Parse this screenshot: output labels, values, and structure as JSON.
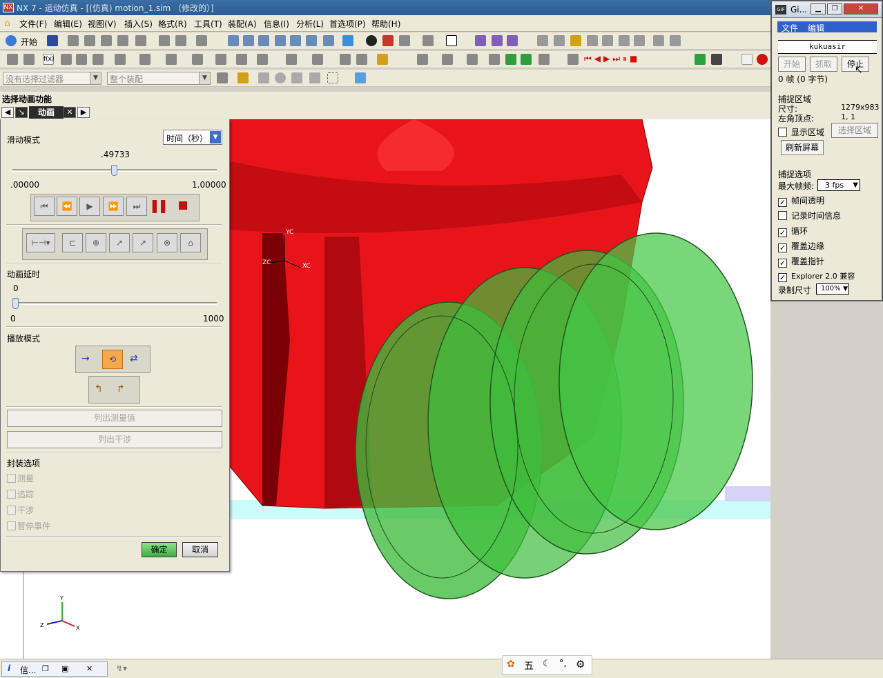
{
  "window": {
    "title": "NX 7 - 运动仿真 - [(仿真) motion_1.sim （修改的）]"
  },
  "menu": [
    "文件(F)",
    "编辑(E)",
    "视图(V)",
    "插入(S)",
    "格式(R)",
    "工具(T)",
    "装配(A)",
    "信息(I)",
    "分析(L)",
    "首选项(P)",
    "帮助(H)"
  ],
  "toolbar": {
    "start_label": "开始",
    "filter_placeholder": "没有选择过滤器",
    "assembly_scope": "整个装配"
  },
  "cue": "选择动画功能",
  "tab": {
    "label": "动画"
  },
  "animation": {
    "slide_mode_label": "滑动模式",
    "slide_mode_value": "时间（秒）",
    "time_value": ".49733",
    "time_fraction": 0.49733,
    "time_min": ".00000",
    "time_max": "1.00000",
    "delay_label": "动画延时",
    "delay_value": "0",
    "delay_min": "0",
    "delay_max": "1000",
    "play_mode_label": "播放模式",
    "list_measure": "列出测量值",
    "list_interference": "列出干涉",
    "package_label": "封装选项",
    "package_options": [
      "测量",
      "追踪",
      "干涉",
      "暂停事件"
    ],
    "ok": "确定",
    "cancel": "取消"
  },
  "csys": {
    "yc": "YC",
    "zc": "ZC",
    "xc": "XC",
    "y": "Y",
    "z": "Z",
    "x": "X"
  },
  "gif": {
    "title": "Gi...",
    "menu": [
      "文件",
      "编辑"
    ],
    "name": "kukuasir",
    "start": "开始",
    "grab": "抓取",
    "stop": "停止",
    "frames": "0 帧 (0 字节)",
    "capture_area_label": "捕捉区域",
    "size_label": "尺寸:",
    "size_value": "1279x983",
    "corner_label": "左角顶点:",
    "corner_value": "1, 1",
    "show_area": "显示区域",
    "select_area": "选择区域",
    "refresh": "刷新屏幕",
    "capture_options_label": "捕捉选项",
    "max_fps_label": "最大帧频:",
    "max_fps_value": "3 fps",
    "options": [
      {
        "label": "帧间透明",
        "checked": true
      },
      {
        "label": "记录时间信息",
        "checked": false
      },
      {
        "label": "循环",
        "checked": true
      },
      {
        "label": "覆盖边缘",
        "checked": true
      },
      {
        "label": "覆盖指针",
        "checked": true
      },
      {
        "label": "Explorer 2.0 兼容",
        "checked": true
      }
    ],
    "record_size_label": "录制尺寸",
    "record_size_value": "100%"
  },
  "statusbar": {
    "info_tab": "信..."
  },
  "ime": {
    "mode": "五"
  },
  "colors": {
    "gear_red": "#e8141a",
    "worm_green": "#3ebd3c",
    "titlebar": "#2a5c93"
  }
}
